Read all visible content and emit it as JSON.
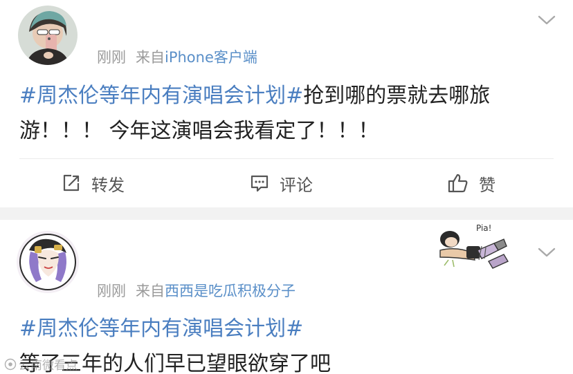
{
  "post1": {
    "time": "刚刚",
    "source_prefix": "来自",
    "source": "iPhone客户端",
    "content": {
      "topic": "#周杰伦等年内有演唱会计划#",
      "text_line1": "抢到哪的票就去哪旅",
      "text_line2": "游！！！ 今年这演唱会我看定了！！！"
    },
    "actions": {
      "repost": "转发",
      "comment": "评论",
      "like": "赞"
    }
  },
  "post2": {
    "time": "刚刚",
    "source_prefix": "来自",
    "source": "西西是吃瓜积极分子",
    "content": {
      "topic": "#周杰伦等年内有演唱会计划#",
      "text": "等了三年的人们早已望眼欲穿了吧"
    },
    "sticker_text": "Pia!"
  },
  "watermark": "云南微看点",
  "colors": {
    "topic": "#4a7ec0",
    "source": "#5a8fc8",
    "meta": "#9a9a9a",
    "text": "#222222",
    "separator": "#f2f2f2"
  },
  "icons": {
    "repost": "edit-share-icon",
    "comment": "comment-bubble-icon",
    "like": "thumbs-up-icon",
    "menu": "chevron-down-icon"
  }
}
